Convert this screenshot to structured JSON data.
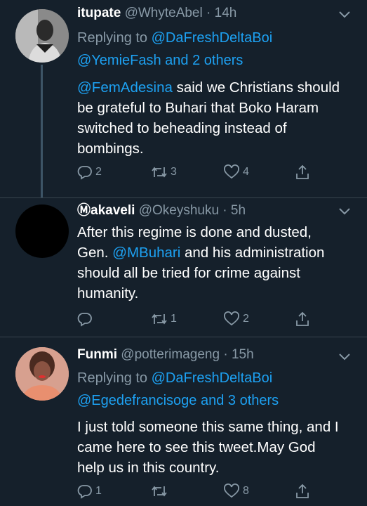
{
  "tweets": [
    {
      "name": "itupate",
      "handle": "@WhyteAbel",
      "time": "14h",
      "replying_prefix": "Replying to ",
      "replying_to": "@DaFreshDeltaBoi",
      "replying_more": "@YemieFash and 2 others",
      "text_mention": "@FemAdesina",
      "text_rest": " said we Christians should be grateful to Buhari that Boko Haram switched to beheading instead of bombings.",
      "replies": "2",
      "retweets": "3",
      "likes": "4"
    },
    {
      "name": "Ⓜakaveli",
      "handle": "@Okeyshuku",
      "time": "5h",
      "text_before": "After this regime is done and dusted, Gen. ",
      "text_mention": "@MBuhari",
      "text_after": " and his administration should all be tried for crime against humanity.",
      "replies": "",
      "retweets": "1",
      "likes": "2"
    },
    {
      "name": "Funmi",
      "handle": "@potterimageng",
      "time": "15h",
      "replying_prefix": "Replying to ",
      "replying_to": "@DaFreshDeltaBoi",
      "replying_more": "@Egedefrancisoge and 3 others",
      "text": "I just told someone this same thing, and I came here to see this tweet.May God help us in this country.",
      "replies": "1",
      "retweets": "",
      "likes": "8"
    }
  ],
  "separator": " · ",
  "colors": {
    "background": "#15202b",
    "secondary_text": "#8899a6",
    "accent": "#1da1f2",
    "divider": "#38444d"
  },
  "icons": [
    "chevron-down-icon",
    "reply-icon",
    "retweet-icon",
    "like-icon",
    "share-icon"
  ]
}
